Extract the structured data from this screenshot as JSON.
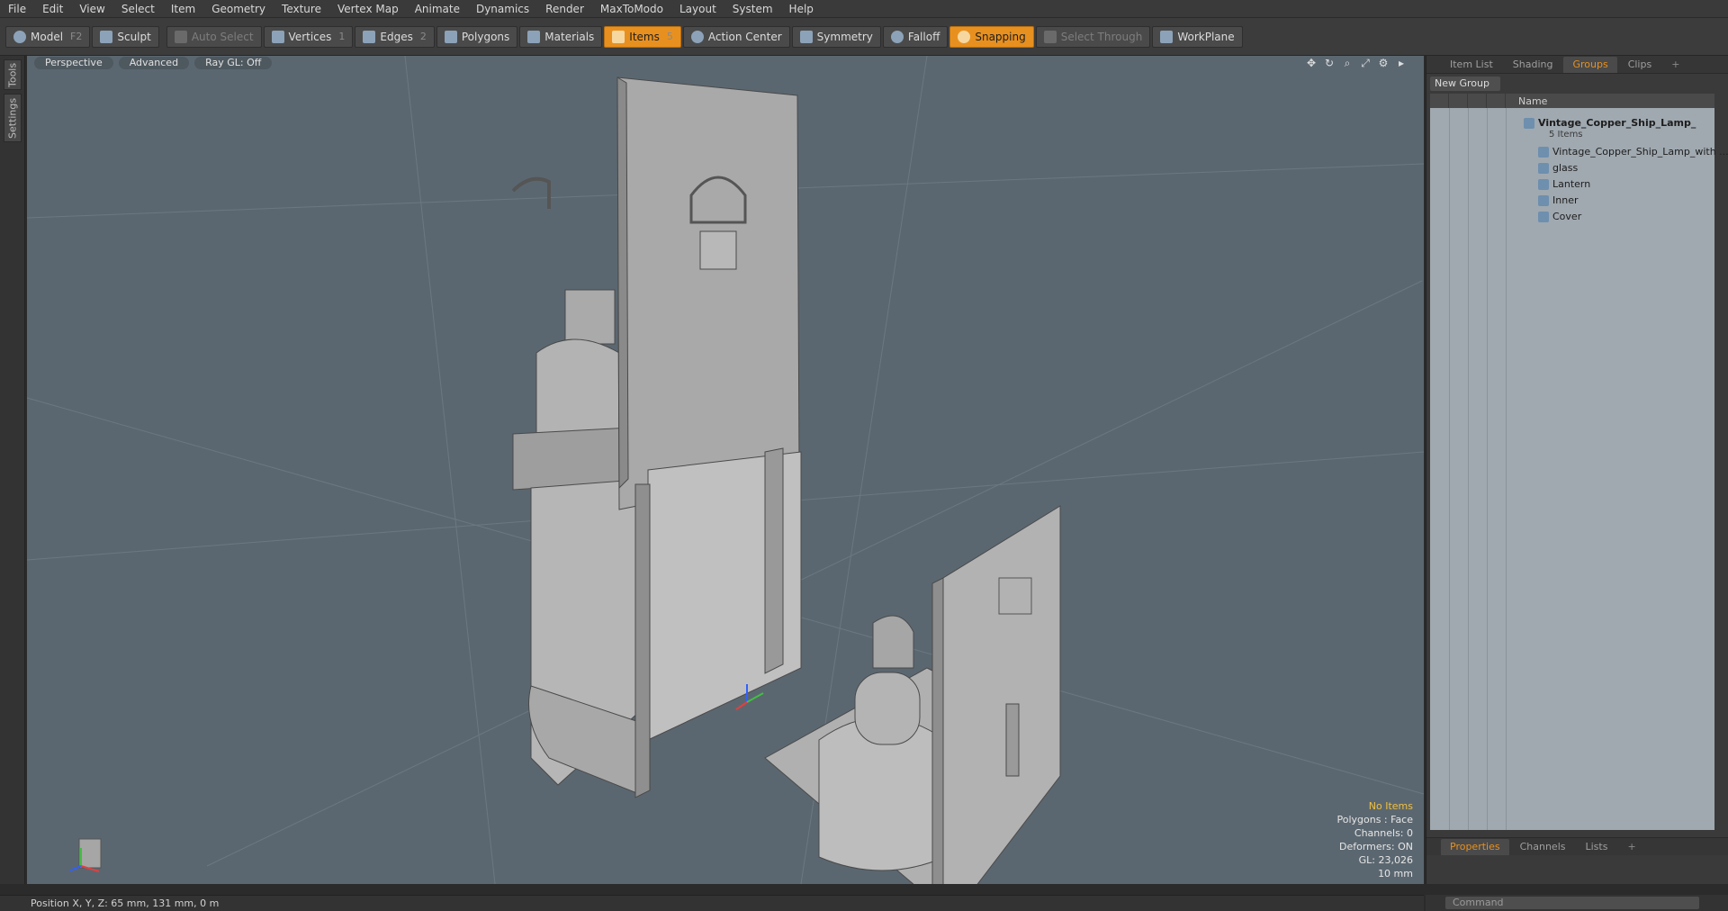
{
  "menu": [
    "File",
    "Edit",
    "View",
    "Select",
    "Item",
    "Geometry",
    "Texture",
    "Vertex Map",
    "Animate",
    "Dynamics",
    "Render",
    "MaxToModo",
    "Layout",
    "System",
    "Help"
  ],
  "toolbar": {
    "model": "Model",
    "model_key": "F2",
    "sculpt": "Sculpt",
    "auto_select": "Auto Select",
    "vertices": "Vertices",
    "vertices_key": "1",
    "edges": "Edges",
    "edges_key": "2",
    "polygons": "Polygons",
    "materials": "Materials",
    "items": "Items",
    "items_key": "5",
    "action_center": "Action Center",
    "symmetry": "Symmetry",
    "falloff": "Falloff",
    "snapping": "Snapping",
    "select_through": "Select Through",
    "workplane": "WorkPlane"
  },
  "left_tabs": {
    "tools": "Tools",
    "settings": "Settings"
  },
  "viewport": {
    "perspective": "Perspective",
    "advanced": "Advanced",
    "raygl": "Ray GL: Off",
    "info": {
      "no_items": "No Items",
      "polygons": "Polygons : Face",
      "channels": "Channels: 0",
      "deformers": "Deformers: ON",
      "gl": "GL: 23,026",
      "scale": "10 mm"
    }
  },
  "panel": {
    "tabs": [
      "Item List",
      "Shading",
      "Groups",
      "Clips",
      "+"
    ],
    "new_group": "New Group",
    "name_col": "Name",
    "group_name": "Vintage_Copper_Ship_Lamp_",
    "group_count": "5 Items",
    "items": [
      "Vintage_Copper_Ship_Lamp_with ...",
      "glass",
      "Lantern",
      "Inner",
      "Cover"
    ],
    "bottom_tabs": [
      "Properties",
      "Channels",
      "Lists",
      "+"
    ],
    "command_placeholder": "Command"
  },
  "status": {
    "position": "Position X, Y, Z:  65 mm, 131 mm, 0 m"
  },
  "colors": {
    "accent": "#e8901f",
    "viewport_bg": "#5b6770",
    "panel_list_bg": "#a0a9b0"
  }
}
